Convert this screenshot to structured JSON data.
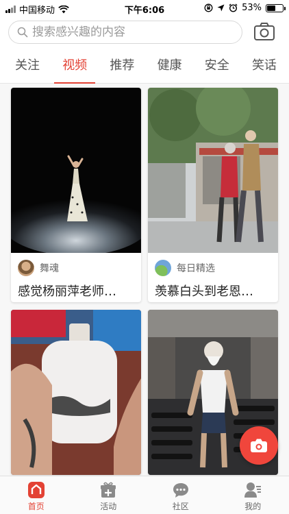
{
  "status_bar": {
    "carrier": "中国移动",
    "time": "下午6:06",
    "battery_text": "53%",
    "battery_level": 0.53
  },
  "search": {
    "placeholder": "搜索感兴趣的内容"
  },
  "tabs": [
    {
      "label": "关注",
      "active": false
    },
    {
      "label": "视频",
      "active": true
    },
    {
      "label": "推荐",
      "active": false
    },
    {
      "label": "健康",
      "active": false
    },
    {
      "label": "安全",
      "active": false
    },
    {
      "label": "笑话",
      "active": false
    }
  ],
  "cards": [
    {
      "author": "舞魂",
      "title": "感觉杨丽萍老师…",
      "image": "dancer-in-white-gown-on-dark-stage"
    },
    {
      "author": "每日精选",
      "title": "羡慕白头到老恩…",
      "image": "elderly-couple-walking-on-street"
    },
    {
      "author": "",
      "title": "",
      "image": "hand-painting-inside-glass-bottle"
    },
    {
      "author": "",
      "title": "",
      "image": "elderly-man-lifting-dumbbells-in-gym"
    }
  ],
  "bottom_nav": [
    {
      "label": "首页",
      "icon": "home-icon",
      "active": true
    },
    {
      "label": "活动",
      "icon": "gift-icon",
      "active": false
    },
    {
      "label": "社区",
      "icon": "chat-bubble-icon",
      "active": false
    },
    {
      "label": "我的",
      "icon": "profile-icon",
      "active": false
    }
  ],
  "colors": {
    "accent": "#e34234",
    "fab": "#f0463c"
  }
}
